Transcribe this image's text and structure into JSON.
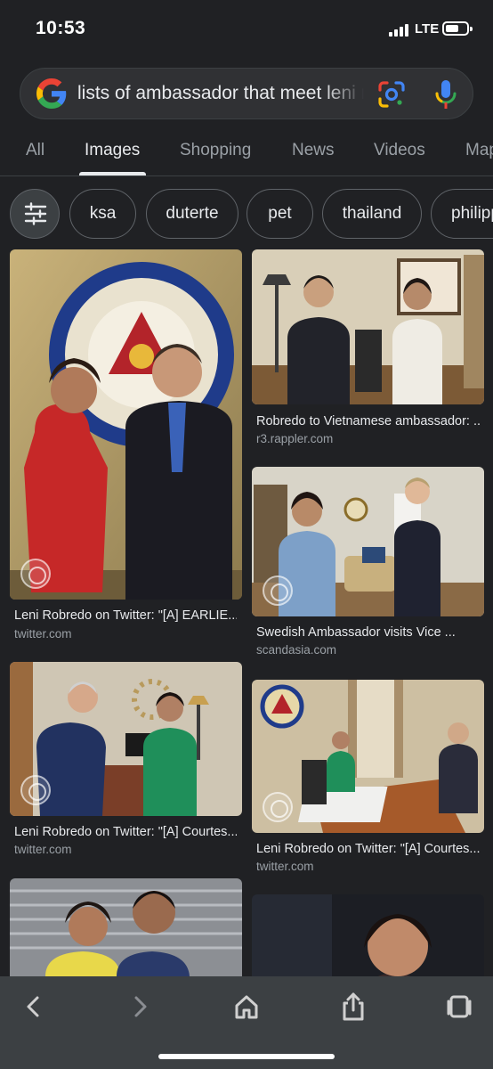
{
  "status": {
    "time": "10:53",
    "network": "LTE"
  },
  "search": {
    "query": "lists of ambassador that meet leni robredo"
  },
  "tabs": [
    {
      "label": "All"
    },
    {
      "label": "Images"
    },
    {
      "label": "Shopping"
    },
    {
      "label": "News"
    },
    {
      "label": "Videos"
    },
    {
      "label": "Maps"
    }
  ],
  "chips": [
    {
      "label": "ksa"
    },
    {
      "label": "duterte"
    },
    {
      "label": "pet"
    },
    {
      "label": "thailand"
    },
    {
      "label": "philippines"
    }
  ],
  "results": [
    {
      "caption": "Leni Robredo on Twitter: \"[A] EARLIE...",
      "source": "twitter.com"
    },
    {
      "caption": "Robredo to Vietnamese ambassador: ...",
      "source": "r3.rappler.com"
    },
    {
      "caption": "Swedish Ambassador visits Vice ...",
      "source": "scandasia.com"
    },
    {
      "caption": "Leni Robredo on Twitter: \"[A] Courtes...",
      "source": "twitter.com"
    },
    {
      "caption": "Leni Robredo on Twitter: \"[A] Courtes...",
      "source": "twitter.com"
    }
  ],
  "icons": {
    "filter": "tune-icon",
    "lens": "google-lens-icon",
    "mic": "microphone-icon",
    "back": "chevron-left-icon",
    "forward": "chevron-right-icon",
    "home": "home-icon",
    "share": "share-icon",
    "tabs": "tabs-icon"
  },
  "colors": {
    "background": "#202124",
    "search_bg": "#303134",
    "bottom_bar": "#3c4043",
    "text_primary": "#e8eaed",
    "text_secondary": "#9aa0a6"
  }
}
